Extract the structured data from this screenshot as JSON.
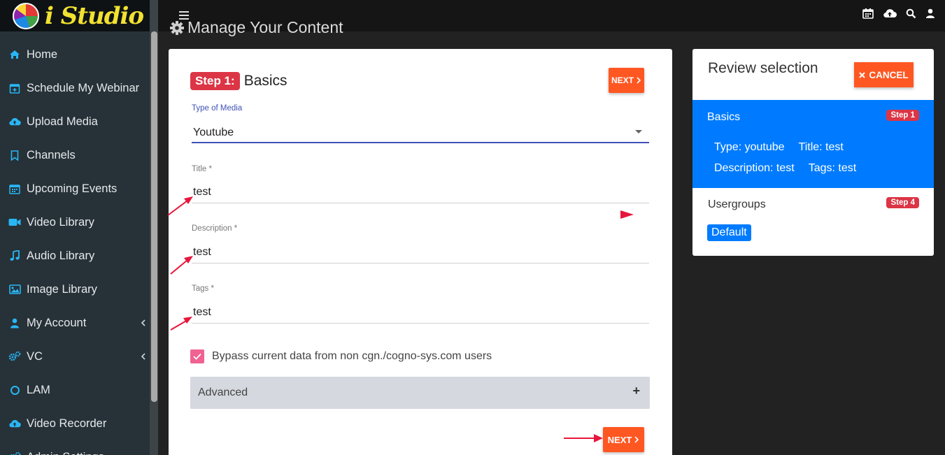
{
  "app": {
    "brand": "i Studio"
  },
  "sidebar": {
    "items": [
      {
        "label": "Home",
        "icon": "home-icon"
      },
      {
        "label": "Schedule My Webinar",
        "icon": "calendar-plus-icon"
      },
      {
        "label": "Upload Media",
        "icon": "cloud-upload-icon"
      },
      {
        "label": "Channels",
        "icon": "bookmark-icon"
      },
      {
        "label": "Upcoming Events",
        "icon": "calendar-icon"
      },
      {
        "label": "Video Library",
        "icon": "video-camera-icon"
      },
      {
        "label": "Audio Library",
        "icon": "music-note-icon"
      },
      {
        "label": "Image Library",
        "icon": "image-icon"
      },
      {
        "label": "My Account",
        "icon": "user-icon",
        "has_submenu": true
      },
      {
        "label": "VC",
        "icon": "cogs-icon",
        "has_submenu": true
      },
      {
        "label": "LAM",
        "icon": "circle-icon"
      },
      {
        "label": "Video Recorder",
        "icon": "cloud-upload-icon"
      },
      {
        "label": "Admin Settings",
        "icon": "cogs-icon"
      }
    ]
  },
  "topbar": {
    "icons": [
      "calendar-icon",
      "cloud-upload-icon",
      "search-icon",
      "user-icon"
    ]
  },
  "page": {
    "title": "Manage Your Content"
  },
  "form": {
    "step_badge": "Step 1:",
    "step_heading": "Basics",
    "next_label": "NEXT",
    "media_type": {
      "label": "Type of Media",
      "value": "Youtube"
    },
    "title": {
      "label": "Title *",
      "value": "test"
    },
    "description": {
      "label": "Description *",
      "value": "test"
    },
    "tags": {
      "label": "Tags *",
      "value": "test"
    },
    "bypass": {
      "label": "Bypass current data from non cgn./cogno-sys.com users",
      "checked": true
    },
    "advanced": {
      "label": "Advanced",
      "toggle": "+"
    }
  },
  "review": {
    "title": "Review selection",
    "cancel_label": "CANCEL",
    "basics": {
      "title": "Basics",
      "step": "Step 1",
      "type": "Type: youtube",
      "title_text": "Title: test",
      "description": "Description: test",
      "tags": "Tags: test"
    },
    "usergroups": {
      "title": "Usergroups",
      "step": "Step 4",
      "group": "Default"
    }
  },
  "colors": {
    "accent": "#ff5722",
    "primary": "#007bff",
    "badge": "#dc3545",
    "checkbox": "#f06292",
    "sidebar_icon": "#29b6f6",
    "annotation_arrow": "#e8163c"
  }
}
